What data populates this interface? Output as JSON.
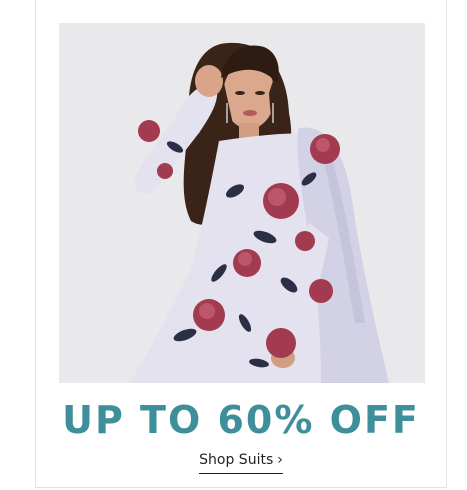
{
  "promo": {
    "headline": "UP TO 60% OFF",
    "cta_label": "Shop Suits",
    "cta_icon": "chevron-right-icon",
    "cta_glyph": "›"
  },
  "colors": {
    "accent": "#3e8f9a",
    "dress": "#e4e2ee",
    "flower": "#a23a50",
    "leaf": "#2b2f45"
  }
}
